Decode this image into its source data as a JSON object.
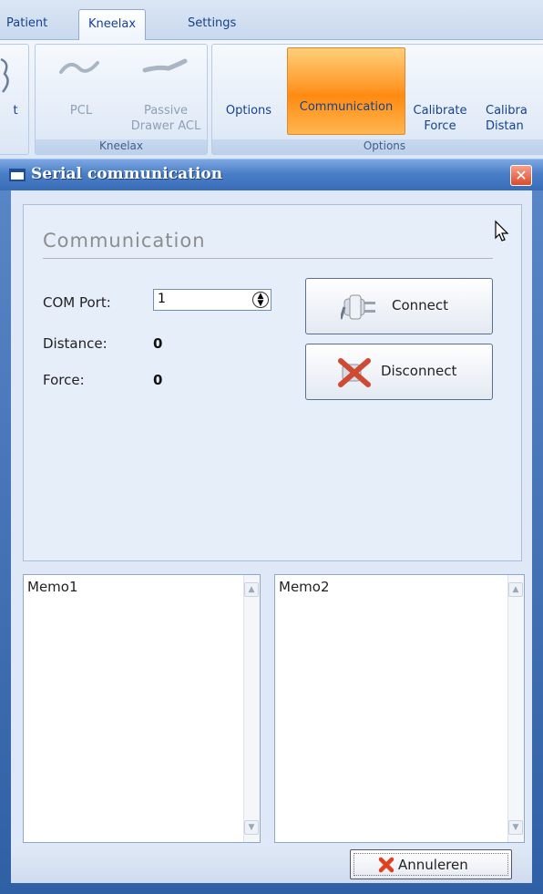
{
  "ribbon": {
    "tabs": [
      {
        "label": "Patient"
      },
      {
        "label": "Kneelax"
      },
      {
        "label": "Settings"
      }
    ],
    "partial_button_label": "t",
    "groups": {
      "kneelax": {
        "label": "Kneelax",
        "buttons": [
          {
            "label": "PCL"
          },
          {
            "label_line1": "Passive",
            "label_line2": "Drawer ACL"
          }
        ]
      },
      "options": {
        "label": "Options",
        "buttons": [
          {
            "label": "Options"
          },
          {
            "label": "Communication"
          },
          {
            "label_line1": "Calibrate",
            "label_line2": "Force"
          },
          {
            "label_line1": "Calibra",
            "label_line2": "Distan"
          }
        ]
      }
    }
  },
  "dialog": {
    "title": "Serial communication",
    "close_glyph": "✕",
    "panel_title": "Communication",
    "com_port_label": "COM Port:",
    "com_port_value": "1",
    "distance_label": "Distance:",
    "distance_value": "0",
    "force_label": "Force:",
    "force_value": "0",
    "connect_label": "Connect",
    "disconnect_label": "Disconnect",
    "memo1": "Memo1",
    "memo2": "Memo2",
    "cancel_label": "Annuleren"
  },
  "colors": {
    "active_orange": "#ff9a2a",
    "dialog_blue": "#3a6db8",
    "close_red": "#dc4a2a"
  }
}
